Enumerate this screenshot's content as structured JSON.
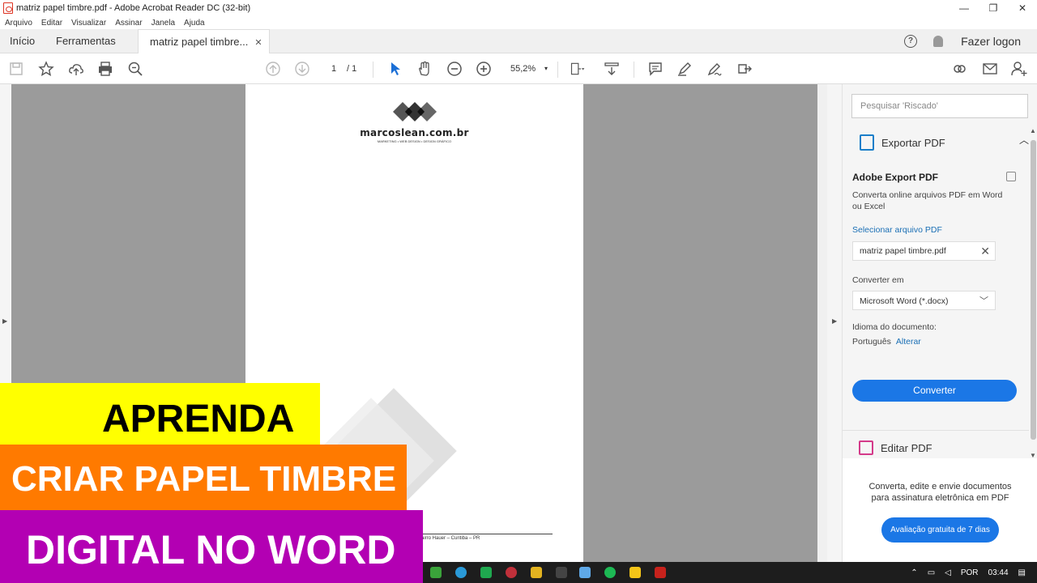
{
  "window": {
    "title": "matriz papel timbre.pdf - Adobe Acrobat Reader DC (32-bit)",
    "controls": [
      "—",
      "❐",
      "✕"
    ]
  },
  "menu": [
    "Arquivo",
    "Editar",
    "Visualizar",
    "Assinar",
    "Janela",
    "Ajuda"
  ],
  "tabs": {
    "home": "Início",
    "tools": "Ferramentas",
    "document": "matriz papel timbre...",
    "close": "✕"
  },
  "account": {
    "help": "?",
    "login": "Fazer logon"
  },
  "toolbar": {
    "page_current": "1",
    "page_total": "/  1",
    "zoom": "55,2%",
    "zoom_caret": "▾"
  },
  "document": {
    "logo_text": "marcoslean.com.br",
    "logo_sub": "MARKETING • WEB DESIGN • DESIGN GRÁFICO",
    "footer": "airro Hauer – Curitiba – PR"
  },
  "right_panel": {
    "search_placeholder": "Pesquisar 'Riscado'",
    "export_title": "Exportar PDF",
    "adobe_export": "Adobe Export PDF",
    "description": "Converta online arquivos PDF em Word ou Excel",
    "select_file": "Selecionar arquivo PDF",
    "file_name": "matriz papel timbre.pdf",
    "convert_to_label": "Converter em",
    "format": "Microsoft Word (*.docx)",
    "language_label": "Idioma do documento:",
    "language": "Português",
    "change": "Alterar",
    "convert_button": "Converter",
    "edit_title": "Editar PDF",
    "promo_line1": "Converta, edite e envie documentos",
    "promo_line2": "para assinatura eletrônica em PDF",
    "trial_button": "Avaliação gratuita de 7 dias"
  },
  "taskbar": {
    "language": "POR",
    "time": "03:44"
  },
  "overlay": {
    "line1": "APRENDA",
    "line2": "CRIAR PAPEL TIMBRE",
    "line3": "DIGITAL NO WORD"
  },
  "colors": {
    "accent": "#1b77e6",
    "banner_yellow": "#ffff00",
    "banner_orange": "#ff7a00",
    "banner_purple": "#b300b3"
  }
}
